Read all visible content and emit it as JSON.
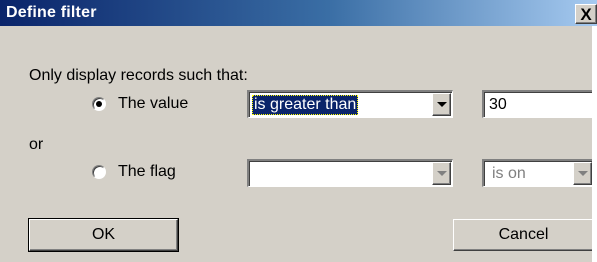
{
  "window": {
    "title": "Define filter",
    "close_label": "X"
  },
  "prompt": "Only display records such that:",
  "value_row": {
    "radio_label": "The value",
    "selected": true,
    "operator": "is greater than",
    "value": "30"
  },
  "or_label": "or",
  "flag_row": {
    "radio_label": "The flag",
    "selected": false,
    "flag": "",
    "state": "is on"
  },
  "buttons": {
    "ok": "OK",
    "cancel": "Cancel"
  },
  "colors": {
    "dialog_bg": "#d4d0c8",
    "title_start": "#0a246a",
    "title_end": "#a6caf0",
    "selection": "#0a246a"
  }
}
